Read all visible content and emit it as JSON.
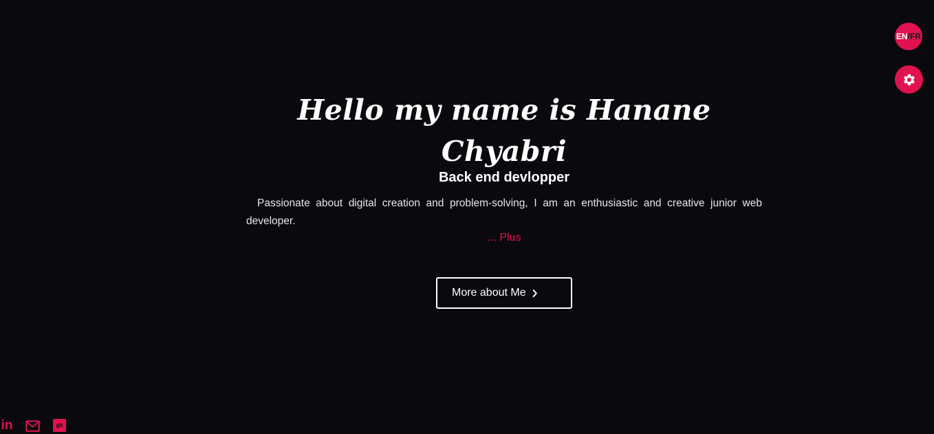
{
  "language_toggle": {
    "en": "EN",
    "separator": "/",
    "fr": "FR"
  },
  "settings": {
    "icon": "gear-icon"
  },
  "hero": {
    "title": "Hello my name is Hanane Chyabri",
    "subtitle": "Back end devlopper",
    "description": "Passionate about digital creation and problem-solving, I am an enthusiastic and creative junior web developer.",
    "more_link": "... Plus"
  },
  "about_button": {
    "label": "More about Me",
    "icon": "chevron-right-icon"
  },
  "socials": {
    "linkedin": {
      "icon": "linkedin-icon",
      "text": "in"
    },
    "mail": {
      "icon": "mail-icon"
    },
    "git": {
      "icon": "git-icon",
      "text": "git"
    }
  },
  "colors": {
    "background": "#0a090e",
    "accent": "#e0124f",
    "text": "#ffffff"
  }
}
